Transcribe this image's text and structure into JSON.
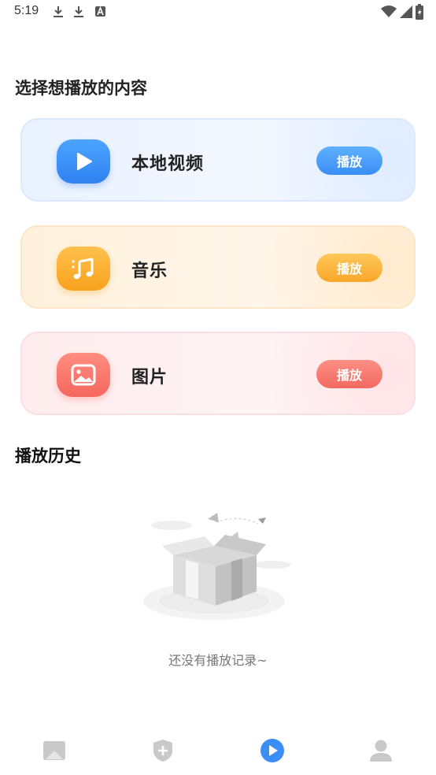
{
  "status_bar": {
    "time": "5:19",
    "icons": [
      "download-icon",
      "download-icon",
      "a-notification-icon",
      "wifi-icon",
      "signal-icon",
      "battery-charging-icon"
    ]
  },
  "section_play": {
    "title": "选择想播放的内容"
  },
  "cards": [
    {
      "key": "video",
      "label": "本地视频",
      "button": "播放",
      "icon": "play-icon",
      "accent": "#3a8ef5"
    },
    {
      "key": "music",
      "label": "音乐",
      "button": "播放",
      "icon": "music-note-icon",
      "accent": "#f8a72a"
    },
    {
      "key": "photo",
      "label": "图片",
      "button": "播放",
      "icon": "image-icon",
      "accent": "#f16960"
    }
  ],
  "section_history": {
    "title": "播放历史",
    "empty_text": "还没有播放记录~"
  },
  "bottom_nav": {
    "items": [
      {
        "name": "gallery-icon",
        "active": false
      },
      {
        "name": "shield-plus-icon",
        "active": false
      },
      {
        "name": "play-circle-icon",
        "active": true
      },
      {
        "name": "user-icon",
        "active": false
      }
    ],
    "active_color": "#3a8ef5",
    "inactive_color": "#c9c9c9"
  }
}
